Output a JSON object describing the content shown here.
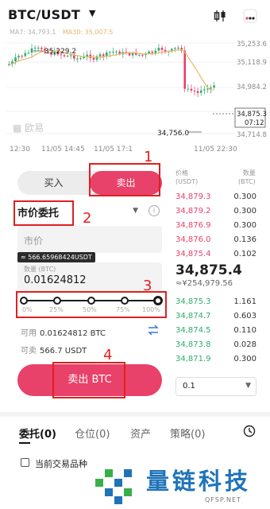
{
  "header": {
    "pair": "BTC/USDT",
    "ma_values": [
      "MA7: 34,793.1",
      "MA30: 35,007.5"
    ],
    "icons": [
      "caret-down-icon",
      "candlestick-icon",
      "more-icon"
    ]
  },
  "chart": {
    "price_labels": [
      "35,253.6",
      "35,118.9",
      "34,984.2",
      "34,714.8"
    ],
    "high_label": "35,229.2",
    "low_label": "34,756.0",
    "current_price": "34,875.3",
    "countdown": "07:12",
    "time_labels": [
      "12:30",
      "11/05 14:45",
      "11/05 17:1",
      "11/05 22:30"
    ],
    "watermark": "欧易",
    "colors": {
      "up": "#2fad6e",
      "down": "#e8416a",
      "ma": "#e9b66a"
    }
  },
  "form": {
    "buy_tab": "买入",
    "sell_tab": "卖出",
    "order_type": "市价委托",
    "market_placeholder": "市价",
    "qty_tip": "≈ 566.65968424USDT",
    "qty_label": "数量 (BTC)",
    "qty_value": "0.01624812",
    "slider_labels": [
      "0%",
      "25%",
      "50%",
      "75%",
      "100%"
    ],
    "slider_percent": 100,
    "available_label": "可用",
    "available_value": "0.01624812 BTC",
    "sellable_label": "可卖",
    "sellable_value": "566.7 USDT",
    "submit_label": "卖出 BTC"
  },
  "orderbook": {
    "price_header": "价格",
    "price_unit": "(USDT)",
    "qty_header": "数量",
    "qty_unit": "(BTC)",
    "asks": [
      {
        "price": "34,879.3",
        "qty": "0.300"
      },
      {
        "price": "34,879.2",
        "qty": "0.300"
      },
      {
        "price": "34,876.9",
        "qty": "0.300"
      },
      {
        "price": "34,876.0",
        "qty": "0.136"
      },
      {
        "price": "34,875.4",
        "qty": "0.102"
      }
    ],
    "last_price": "34,875.4",
    "last_fiat": "≈¥254,979.56",
    "bids": [
      {
        "price": "34,875.3",
        "qty": "1.161"
      },
      {
        "price": "34,874.7",
        "qty": "0.603"
      },
      {
        "price": "34,874.5",
        "qty": "0.110"
      },
      {
        "price": "34,873.8",
        "qty": "0.028"
      },
      {
        "price": "34,871.9",
        "qty": "0.300"
      }
    ],
    "precision": "0.1"
  },
  "bottom": {
    "tabs": [
      "委托(0)",
      "仓位(0)",
      "资产",
      "策略(0)"
    ],
    "checkbox_label": "当前交易品种"
  },
  "annotations": [
    "1",
    "2",
    "3",
    "4"
  ],
  "watermark": {
    "brand": "量链科技",
    "site": "QFSP.NET"
  }
}
